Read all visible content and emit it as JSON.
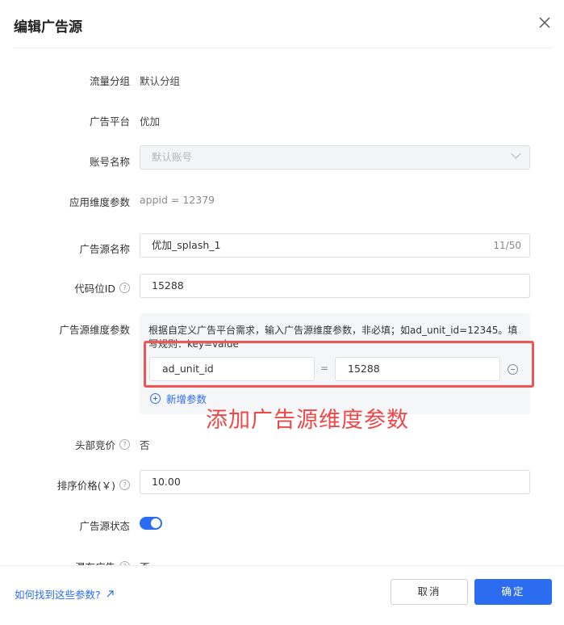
{
  "dialog": {
    "title": "编辑广告源"
  },
  "fields": {
    "traffic_group": {
      "label": "流量分组",
      "value": "默认分组"
    },
    "ad_platform": {
      "label": "广告平台",
      "value": "优加"
    },
    "account_name": {
      "label": "账号名称",
      "placeholder": "默认账号"
    },
    "app_params": {
      "label": "应用维度参数",
      "value": "appid = 12379"
    },
    "ad_source_name": {
      "label": "广告源名称",
      "value": "优加_splash_1",
      "counter": "11/50"
    },
    "slot_id": {
      "label": "代码位ID",
      "value": "15288"
    },
    "ad_source_params": {
      "label": "广告源维度参数",
      "description": "根据自定义广告平台需求，输入广告源维度参数，非必填；如ad_unit_id=12345。填写规则：key=value",
      "key": "ad_unit_id",
      "equals": "=",
      "value": "15288",
      "add_label": "新增参数"
    },
    "header_bidding": {
      "label": "头部竞价",
      "value": "否"
    },
    "sort_price": {
      "label": "排序价格(￥)",
      "value": "10.00"
    },
    "status": {
      "label": "广告源状态",
      "enabled": true
    },
    "partial": {
      "label": "瀑布广告",
      "value": "否"
    }
  },
  "annotation": {
    "text": "添加广告源维度参数",
    "color": "#f04848"
  },
  "footer": {
    "help_link": "如何找到这些参数?",
    "cancel": "取消",
    "ok": "确定"
  },
  "colors": {
    "primary": "#2c6cf0",
    "highlight": "#f05454"
  }
}
